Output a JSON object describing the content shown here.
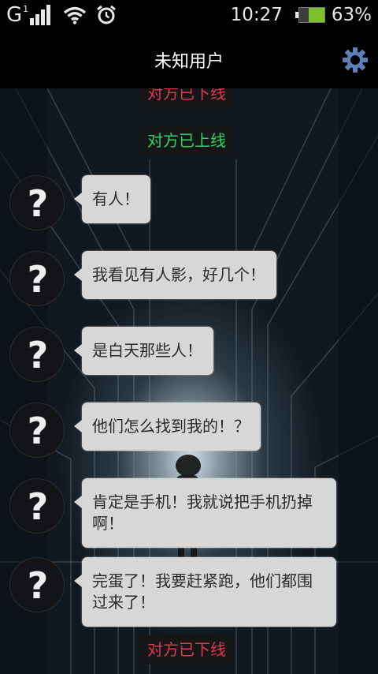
{
  "status_bar": {
    "network_type": "G",
    "sim_index": "1",
    "signal_bars": 4,
    "time": "10:27",
    "battery_level": 0.63,
    "battery_percent": "63%",
    "icons": [
      "signal-icon",
      "wifi-icon",
      "alarm-icon",
      "battery-icon"
    ]
  },
  "header": {
    "title": "未知用户",
    "settings_icon": "gear-icon",
    "accent_color": "#5b7fb9"
  },
  "chat": {
    "notices": [
      {
        "text": "对方已下线",
        "status": "offline",
        "color": "#e0394e"
      },
      {
        "text": "对方已上线",
        "status": "online",
        "color": "#2fd46a"
      },
      {
        "text": "对方已下线",
        "status": "offline",
        "color": "#e0394e"
      }
    ],
    "messages": [
      {
        "avatar": "?",
        "text": "有人！"
      },
      {
        "avatar": "?",
        "text": "我看见有人影，好几个！"
      },
      {
        "avatar": "?",
        "text": "是白天那些人！"
      },
      {
        "avatar": "?",
        "text": "他们怎么找到我的！？"
      },
      {
        "avatar": "?",
        "text": "肯定是手机！我就说把手机扔掉啊！"
      },
      {
        "avatar": "?",
        "text": "完蛋了！我要赶紧跑，他们都围过来了！"
      }
    ]
  }
}
